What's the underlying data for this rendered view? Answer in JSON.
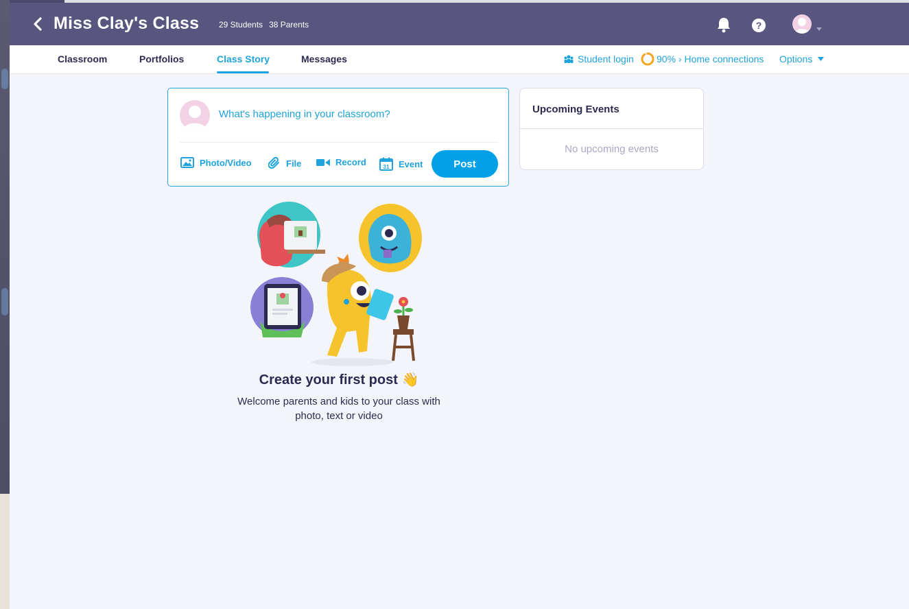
{
  "header": {
    "title": "Miss Clay's Class",
    "students": "29 Students",
    "parents": "38 Parents",
    "help_glyph": "?"
  },
  "tabs": [
    {
      "label": "Classroom"
    },
    {
      "label": "Portfolios"
    },
    {
      "label": "Class Story",
      "active": true
    },
    {
      "label": "Messages"
    }
  ],
  "subnav_right": {
    "student_login": "Student login",
    "home_connections": "90% › Home connections",
    "home_connections_percent": 90,
    "options": "Options"
  },
  "composer": {
    "placeholder": "What's happening in your classroom?",
    "actions": {
      "photo_video": "Photo/Video",
      "file": "File",
      "record": "Record",
      "event": "Event",
      "event_icon_day": "31"
    },
    "post_label": "Post"
  },
  "events": {
    "title": "Upcoming Events",
    "empty": "No upcoming events"
  },
  "empty_state": {
    "title": "Create your first post 👋",
    "subtitle": "Welcome parents and kids to your class with photo, text or video"
  },
  "colors": {
    "header_bg": "#58557f",
    "accent_blue": "#1fa3dd",
    "post_button": "#02a0e6",
    "ring_orange": "#f5a623"
  },
  "icons": [
    "back-chevron-icon",
    "bell-icon",
    "help-icon",
    "avatar-icon",
    "caret-down-icon",
    "student-login-icon",
    "progress-ring-icon",
    "photo-icon",
    "paperclip-icon",
    "video-icon",
    "calendar-icon"
  ]
}
